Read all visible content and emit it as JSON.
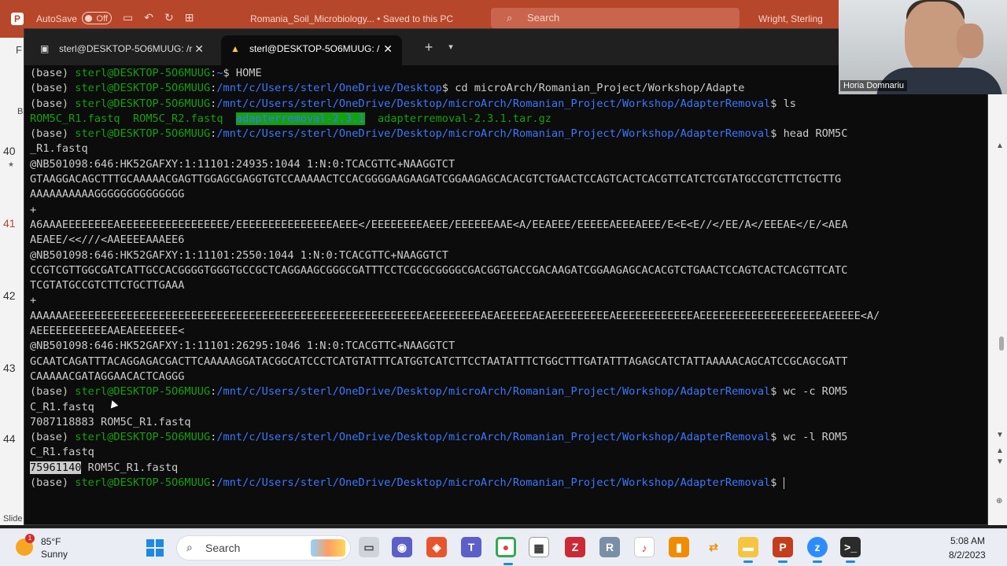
{
  "ppt": {
    "logo": "P",
    "autosave_label": "AutoSave",
    "autosave_state": "Off",
    "doc_title": "Romania_Soil_Microbiology... • Saved to this PC",
    "search_placeholder": "Search",
    "user_name": "Wright, Sterling",
    "left_letter": "F",
    "left_letter2": "B",
    "slide_numbers": [
      "40",
      "41",
      "42",
      "43",
      "44"
    ],
    "slide_label": "Slide"
  },
  "terminal": {
    "tabs": [
      {
        "label": "sterl@DESKTOP-5O6MUUG: /r",
        "icon": "terminal-icon"
      },
      {
        "label": "sterl@DESKTOP-5O6MUUG: /",
        "icon": "linux-penguin-icon"
      }
    ],
    "new_tab": "+",
    "prompt": {
      "env": "(base) ",
      "user": "sterl@DESKTOP-5O6MUUG",
      "path_home": "~",
      "path_home_root": "/mnt/c/Users/sterl/OneDrive/Desktop",
      "path_full": "/mnt/c/Users/sterl/OneDrive/Desktop/microArch/Romanian_Project/Workshop/AdapterRemoval",
      "dollar": "$ "
    },
    "commands": {
      "c1": "HOME",
      "c2": "cd microArch/Romanian_Project/Workshop/Adapte",
      "c3": "ls",
      "c4a": "head ROM5C",
      "c4b": "_R1.fastq",
      "c5a": "wc -c ROM5",
      "c5b": "C_R1.fastq",
      "c6a": "wc -l ROM5",
      "c6b": "C_R1.fastq"
    },
    "ls_output": {
      "f1": "ROM5C_R1.fastq  ROM5C_R2.fastq  ",
      "dir": "adapterremoval-2.3.1",
      "f2": "  adapterremoval-2.3.1.tar.gz"
    },
    "fastq_lines": [
      "@NB501098:646:HK52GAFXY:1:11101:24935:1044 1:N:0:TCACGTTC+NAAGGTCT",
      "GTAAGGACAGCTTTGCAAAAACGAGTTGGAGCGAGGTGTCCAAAAACTCCACGGGGAAGAAGATCGGAAGAGCACACGTCTGAACTCCAGTCACTCACGTTCATCTCGTATGCCGTCTTCTGCTTG",
      "AAAAAAAAAAGGGGGGGGGGGGGG",
      "+",
      "A6AAAEEEEEEEEAEEEEEEEEEEEEEEEEE/EEEEEEEEEEEEEEEAEEE</EEEEEEEEAEEE/EEEEEEAAE<A/EEAEEE/EEEEEAEEEAEEE/E<E<E//</EE/A</EEEAE</E/<AEA",
      "AEAEE/<<///<AAEEEEAAAEE6",
      "@NB501098:646:HK52GAFXY:1:11101:2550:1044 1:N:0:TCACGTTC+NAAGGTCT",
      "CCGTCGTTGGCGATCATTGCCACGGGGTGGGTGCCGCTCAGGAAGCGGGCGATTTCCTCGCGCGGGGCGACGGTGACCGACAAGATCGGAAGAGCACACGTCTGAACTCCAGTCACTCACGTTCATC",
      "TCGTATGCCGTCTTCTGCTTGAAA",
      "+",
      "AAAAAAEEEEEEEEEEEEEEEEEEEEEEEEEEEEEEEEEEEEEEEEEEEEEEEEEEEEEEEAEEEEEEEEAEAEEEEEAEAEEEEEEEEEAEEEEEEEEEEEEAEEEEEEEEEEEEEEEEEEEAEEEEE<A/",
      "AEEEEEEEEEEEAAEAEEEEEEE<",
      "@NB501098:646:HK52GAFXY:1:11101:26295:1046 1:N:0:TCACGTTC+NAAGGTCT",
      "GCAATCAGATTTACAGGAGACGACTTCAAAAAGGATACGGCATCCCTCATGTATTTCATGGTCATCTTCCTAATATTTCTGGCTTTGATATTTAGAGCATCTATTAAAAACAGCATCCGCAGCGATT",
      "CAAAAACGATAGGAACACTCAGGG"
    ],
    "wc_c_output": "7087118883 ROM5C_R1.fastq",
    "wc_l_count": "75961140",
    "wc_l_file": " ROM5C_R1.fastq"
  },
  "webcam": {
    "participant": "Horia Domnariu"
  },
  "taskbar": {
    "weather_badge": "1",
    "temperature": "85°F",
    "condition": "Sunny",
    "search_label": "Search",
    "time": "5:08 AM",
    "date": "8/2/2023",
    "app_icons": [
      "file-explorer-icon",
      "teams-meet-icon",
      "office-icon",
      "teams-icon",
      "chrome-icon",
      "zotero-icon",
      "zotero-alt-icon",
      "r-icon",
      "itunes-icon",
      "files-icon",
      "winscp-icon",
      "folder-icon",
      "powerpoint-icon",
      "zoom-icon",
      "terminal-icon"
    ],
    "chrome_badge": "5"
  },
  "colors": {
    "terminal_bg": "#0c0c0c",
    "prompt_green": "#13a10e",
    "path_blue": "#3b78ff",
    "ppt_red": "#b7472a"
  }
}
